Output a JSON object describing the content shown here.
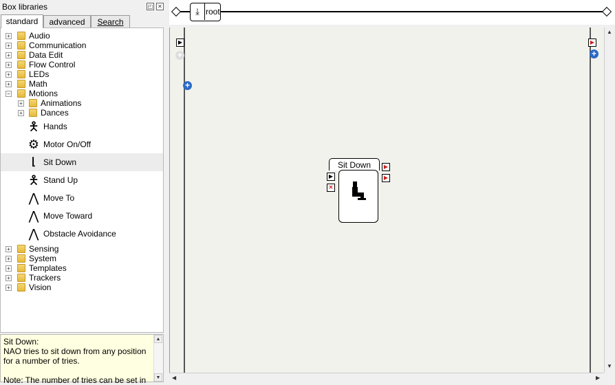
{
  "panel": {
    "title": "Box libraries",
    "tabs": [
      {
        "label": "standard",
        "active": true
      },
      {
        "label": "advanced",
        "active": false
      },
      {
        "label": "Search",
        "active": false
      }
    ]
  },
  "tree": {
    "top_folders": [
      {
        "label": "Audio",
        "expanded": false
      },
      {
        "label": "Communication",
        "expanded": false
      },
      {
        "label": "Data Edit",
        "expanded": false
      },
      {
        "label": "Flow Control",
        "expanded": false
      },
      {
        "label": "LEDs",
        "expanded": false
      },
      {
        "label": "Math",
        "expanded": false
      },
      {
        "label": "Motions",
        "expanded": true
      }
    ],
    "motion_subfolders": [
      {
        "label": "Animations"
      },
      {
        "label": "Dances"
      }
    ],
    "motion_boxes": [
      {
        "label": "Hands",
        "icon": "robot-figure-icon"
      },
      {
        "label": "Motor On/Off",
        "icon": "gears-icon"
      },
      {
        "label": "Sit Down",
        "icon": "sit-down-icon",
        "selected": true
      },
      {
        "label": "Stand Up",
        "icon": "robot-figure-icon"
      },
      {
        "label": "Move To",
        "icon": "walking-legs-icon"
      },
      {
        "label": "Move Toward",
        "icon": "walking-legs-icon"
      },
      {
        "label": "Obstacle Avoidance",
        "icon": "walking-legs-icon"
      }
    ],
    "bottom_folders": [
      {
        "label": "Sensing"
      },
      {
        "label": "System"
      },
      {
        "label": "Templates"
      },
      {
        "label": "Trackers"
      },
      {
        "label": "Vision"
      }
    ]
  },
  "description": {
    "title": "Sit Down:",
    "body": "NAO tries to sit down from any position for a number of tries.",
    "note": "Note: The number of tries can be set in"
  },
  "breadcrumb": {
    "label": "root"
  },
  "diagram": {
    "box_title": "Sit Down"
  },
  "colors": {
    "plus_button": "#2a6ac8",
    "stop_input": "#d02020",
    "output_marker": "#c81e1e",
    "canvas_bg": "#f2f2ed",
    "description_bg": "#ffffe1"
  }
}
